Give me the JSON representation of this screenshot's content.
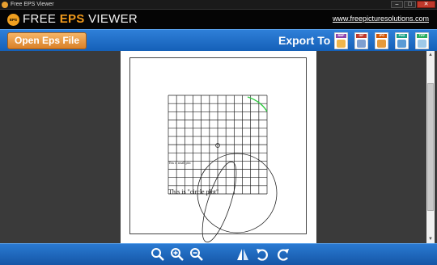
{
  "window": {
    "title": "Free EPS Viewer",
    "min": "–",
    "max": "□",
    "close": "✕"
  },
  "header": {
    "logo_badge": "EPS",
    "logo_part1": "FREE ",
    "logo_part2": "EPS",
    "logo_part3": " VIEWER",
    "site_link": "www.freepicturesolutions.com"
  },
  "toolbar": {
    "open_label": "Open Eps File",
    "export_label": "Export To",
    "export_formats": [
      {
        "tag": "BMP",
        "color": "#8e44ad",
        "art": "#f0b64b"
      },
      {
        "tag": "GIF",
        "color": "#c0392b",
        "art": "#7e9fd0"
      },
      {
        "tag": "JPG",
        "color": "#d35400",
        "art": "#e59a3b"
      },
      {
        "tag": "PNG",
        "color": "#16a085",
        "art": "#5b9bd5"
      },
      {
        "tag": "TIFF",
        "color": "#27ae60",
        "art": "#9ec9e8"
      }
    ]
  },
  "document": {
    "label_small": "This is small plot",
    "label_circle": "This is \"circle plot\""
  },
  "bottom_tools": [
    {
      "name": "zoom-fit-icon"
    },
    {
      "name": "zoom-in-icon"
    },
    {
      "name": "zoom-out-icon"
    },
    {
      "name": "flip-icon"
    },
    {
      "name": "rotate-right-icon"
    },
    {
      "name": "rotate-left-icon"
    }
  ]
}
